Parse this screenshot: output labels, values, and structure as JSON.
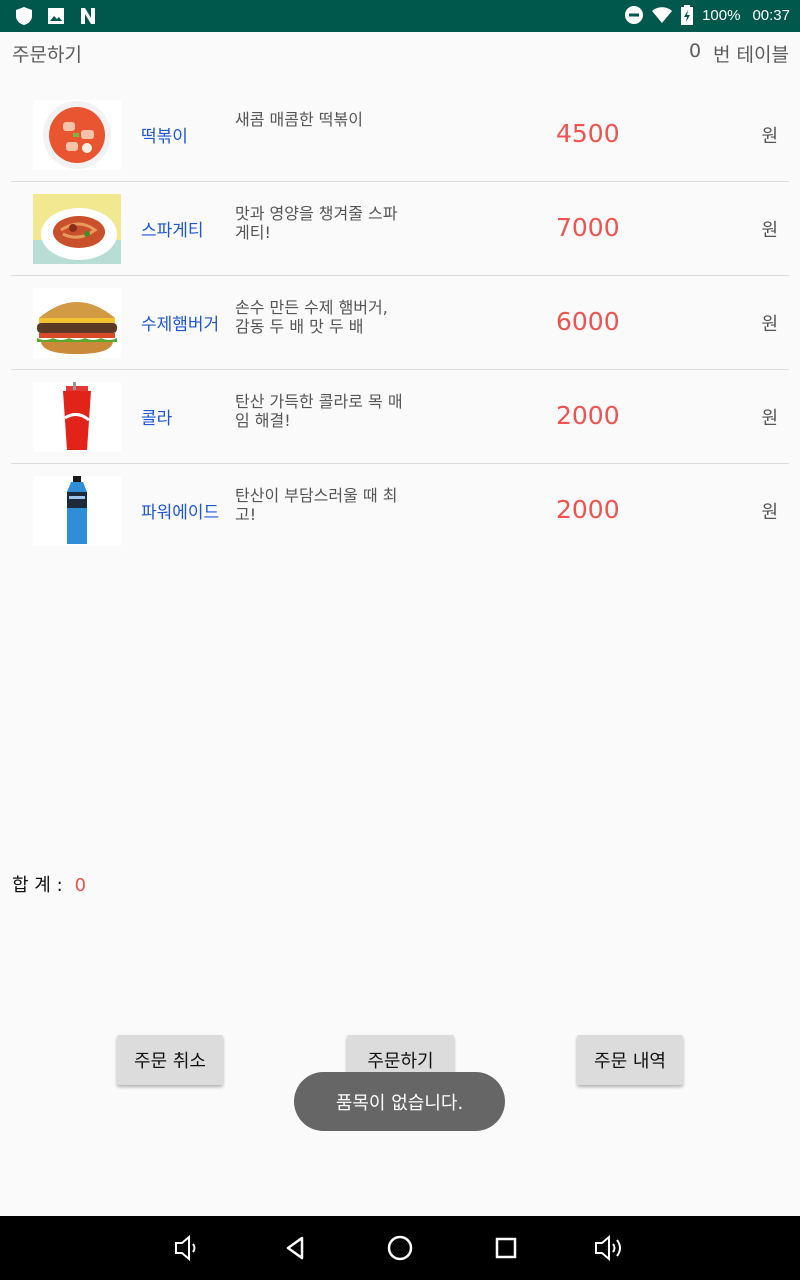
{
  "status_bar": {
    "battery": "100%",
    "time": "00:37"
  },
  "header": {
    "title": "주문하기",
    "table_number": "0",
    "table_label": "번 테이블"
  },
  "menu": [
    {
      "name": "떡볶이",
      "desc": "새콤 매콤한 떡볶이",
      "price": "4500",
      "unit": "원"
    },
    {
      "name": "스파게티",
      "desc": "맛과 영양을 챙겨줄 스파게티!",
      "price": "7000",
      "unit": "원"
    },
    {
      "name": "수제햄버거",
      "desc": "손수 만든 수제 햄버거, 감동 두 배 맛 두 배",
      "price": "6000",
      "unit": "원"
    },
    {
      "name": "콜라",
      "desc": "탄산 가득한 콜라로 목 매임 해결!",
      "price": "2000",
      "unit": "원"
    },
    {
      "name": "파워에이드",
      "desc": "탄산이 부담스러울 때 최고!",
      "price": "2000",
      "unit": "원"
    }
  ],
  "total": {
    "label": "합 계 :",
    "value": "0"
  },
  "buttons": {
    "cancel": "주문 취소",
    "order": "주문하기",
    "history": "주문 내역"
  },
  "toast": "품목이 없습니다.",
  "colors": {
    "status_bar": "#00574b",
    "price": "#ef5350",
    "name": "#1e56d6"
  }
}
